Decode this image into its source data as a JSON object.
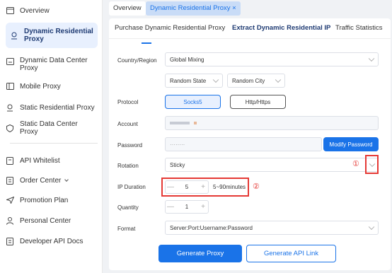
{
  "sidebar": {
    "items": [
      {
        "label": "Overview",
        "icon": "window-icon"
      },
      {
        "label": "Dynamic Residential\nProxy",
        "icon": "location-pin-icon",
        "active": true
      },
      {
        "label": "Dynamic Data Center\nProxy",
        "icon": "server-icon"
      },
      {
        "label": "Mobile Proxy",
        "icon": "mobile-icon"
      },
      {
        "label": "Static Residential Proxy",
        "icon": "location-pin-icon"
      },
      {
        "label": "Static Data Center Proxy",
        "icon": "shield-icon"
      },
      {
        "label": "API Whitelist",
        "icon": "document-icon"
      },
      {
        "label": "Order Center",
        "icon": "clipboard-icon",
        "has_caret": true
      },
      {
        "label": "Promotion Plan",
        "icon": "send-icon"
      },
      {
        "label": "Personal Center",
        "icon": "user-icon"
      },
      {
        "label": "Developer API Docs",
        "icon": "document-icon"
      }
    ]
  },
  "tabs": {
    "overview": "Overview",
    "active": "Dynamic Residential Proxy ×"
  },
  "subtabs": {
    "purchase": "Purchase Dynamic Residential Proxy",
    "extract": "Extract Dynamic Residential IP",
    "stats": "Traffic Statistics"
  },
  "form": {
    "country_label": "Country/Region",
    "country_value": "Global Mixing",
    "state_value": "Random State",
    "city_value": "Random City",
    "protocol_label": "Protocol",
    "protocol_options": [
      "Socks5",
      "Http/Https"
    ],
    "protocol_selected": "Socks5",
    "account_label": "Account",
    "password_label": "Password",
    "password_value": "········",
    "modify_password": "Modify Password",
    "rotation_label": "Rotation",
    "rotation_value": "Sticky",
    "ip_duration_label": "IP Duration",
    "ip_duration_value": "5",
    "ip_duration_hint": "5~90minutes",
    "quantity_label": "Quantity",
    "quantity_value": "1",
    "format_label": "Format",
    "format_value": "Server:Port:Username:Password",
    "generate_proxy": "Generate Proxy",
    "generate_api": "Generate API Link",
    "annotation_1": "①",
    "annotation_2": "②",
    "stepper_minus": "—",
    "stepper_plus": "+"
  },
  "colors": {
    "primary": "#1a73e8",
    "annotation_red": "#e53935",
    "active_tab_bg": "#c9dcf7"
  }
}
